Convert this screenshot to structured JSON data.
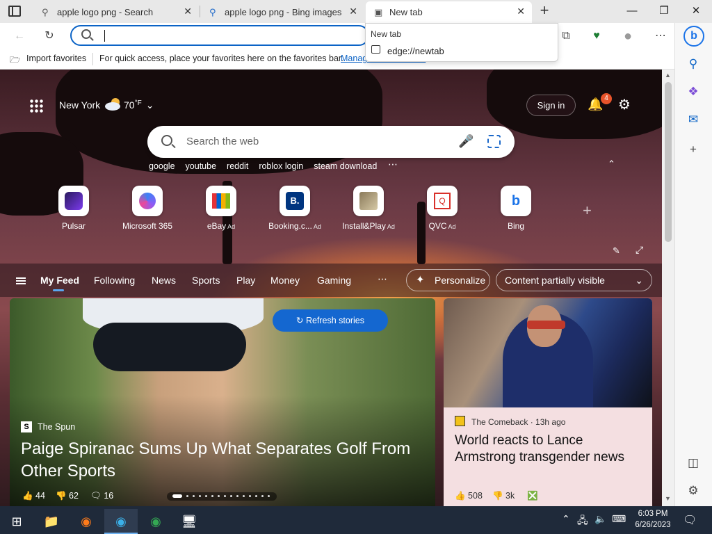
{
  "tabs": [
    {
      "title": "apple logo png - Search",
      "icon": "search-icon"
    },
    {
      "title": "apple logo png - Bing images",
      "icon": "search-icon"
    },
    {
      "title": "New tab",
      "icon": "newtab-icon",
      "active": true
    }
  ],
  "address": {
    "value": ""
  },
  "dropdown": {
    "title": "New tab",
    "url": "edge://newtab"
  },
  "favorites": {
    "import_label": "Import favorites",
    "message": "For quick access, place your favorites here on the favorites bar.",
    "manage_label": "Manage favorites now"
  },
  "weather": {
    "city": "New York",
    "temp": "70",
    "unit": "°F"
  },
  "header": {
    "signin_label": "Sign in",
    "notification_count": "4"
  },
  "search": {
    "placeholder": "Search the web",
    "trending": [
      "google",
      "youtube",
      "reddit",
      "roblox login",
      "steam download"
    ]
  },
  "quick_links": [
    {
      "label": "Pulsar",
      "ad": ""
    },
    {
      "label": "Microsoft 365",
      "ad": ""
    },
    {
      "label": "eBay",
      "ad": "Ad"
    },
    {
      "label": "Booking.c...",
      "ad": "Ad"
    },
    {
      "label": "Install&Play",
      "ad": "Ad"
    },
    {
      "label": "QVC",
      "ad": "Ad"
    },
    {
      "label": "Bing",
      "ad": ""
    }
  ],
  "feed_nav": {
    "items": [
      "My Feed",
      "Following",
      "News",
      "Sports",
      "Play",
      "Money",
      "Gaming"
    ],
    "personalize_label": "Personalize",
    "visibility_label": "Content partially visible"
  },
  "stories": {
    "refresh_label": "Refresh stories",
    "main": {
      "source": "The Spun",
      "title": "Paige Spiranac Sums Up What Separates Golf From Other Sports",
      "likes": "44",
      "dislikes": "62",
      "comments": "16"
    },
    "side": {
      "source": "The Comeback · 13h ago",
      "title": "World reacts to Lance Armstrong transgender news",
      "likes": "508",
      "dislikes": "3k"
    }
  },
  "taskbar": {
    "time": "6:03 PM",
    "date": "6/26/2023"
  },
  "colors": {
    "accent": "#0b63c6",
    "refresh_button": "#1467d0",
    "badge": "#e8542b"
  }
}
